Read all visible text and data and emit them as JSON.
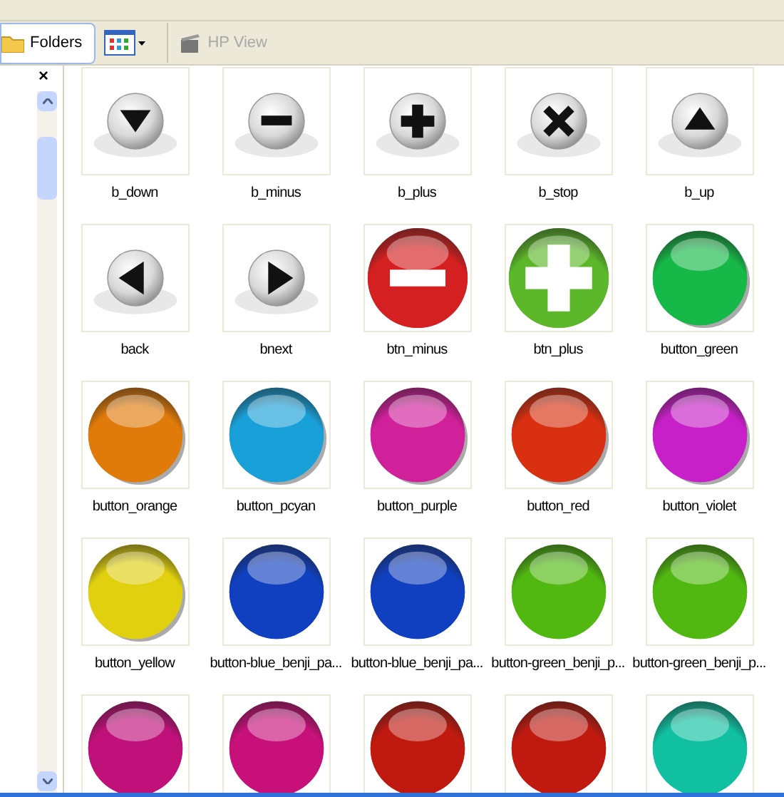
{
  "toolbar": {
    "folders": {
      "label": "Folders",
      "selected": true
    },
    "view_button": {
      "selected": false
    },
    "hp_view": {
      "label": "HP View",
      "disabled": true
    }
  },
  "folders_pane": {
    "close": "×"
  },
  "items": [
    {
      "name": "b_down",
      "kind": "down"
    },
    {
      "name": "b_minus",
      "kind": "minus"
    },
    {
      "name": "b_plus",
      "kind": "plus"
    },
    {
      "name": "b_stop",
      "kind": "stop"
    },
    {
      "name": "b_up",
      "kind": "up"
    },
    {
      "name": "back",
      "kind": "left"
    },
    {
      "name": "bnext",
      "kind": "right"
    },
    {
      "name": "btn_minus",
      "kind": "ball-minus",
      "color": "#d42020"
    },
    {
      "name": "btn_plus",
      "kind": "ball-plus",
      "color": "#5cb82a"
    },
    {
      "name": "button_green",
      "kind": "ball-shadow",
      "color": "#16b848"
    },
    {
      "name": "button_orange",
      "kind": "ball-shadow",
      "color": "#e07a0a"
    },
    {
      "name": "button_pcyan",
      "kind": "ball-shadow",
      "color": "#1aa0d8"
    },
    {
      "name": "button_purple",
      "kind": "ball-shadow",
      "color": "#d0209a"
    },
    {
      "name": "button_red",
      "kind": "ball-shadow",
      "color": "#d83010"
    },
    {
      "name": "button_violet",
      "kind": "ball-shadow",
      "color": "#c820c8"
    },
    {
      "name": "button_yellow",
      "kind": "ball-shadow",
      "color": "#e0d010"
    },
    {
      "name": "button-blue_benji_pa...",
      "kind": "ball",
      "color": "#1040c0"
    },
    {
      "name": "button-blue_benji_pa...",
      "kind": "ball",
      "color": "#1040c0"
    },
    {
      "name": "button-green_benji_p...",
      "kind": "ball",
      "color": "#50b810"
    },
    {
      "name": "button-green_benji_p...",
      "kind": "ball",
      "color": "#50b810"
    },
    {
      "kind": "ball",
      "color": "#c0107a"
    },
    {
      "kind": "ball",
      "color": "#c8107a"
    },
    {
      "kind": "ball",
      "color": "#c01a10"
    },
    {
      "kind": "ball",
      "color": "#c01a10"
    },
    {
      "kind": "ball",
      "color": "#10c0a0"
    }
  ]
}
